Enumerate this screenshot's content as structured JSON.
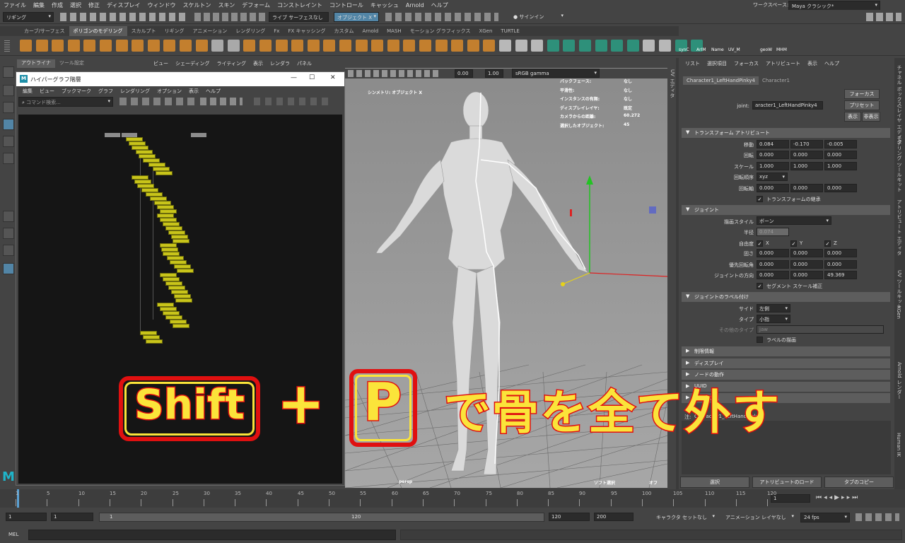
{
  "menubar": [
    "ファイル",
    "編集",
    "作成",
    "選択",
    "修正",
    "ディスプレイ",
    "ウィンドウ",
    "スケルトン",
    "スキン",
    "デフォーム",
    "コンストレイント",
    "コントロール",
    "キャッシュ",
    "Arnold",
    "ヘルプ"
  ],
  "workspace": {
    "label": "ワークスペース:",
    "value": "Maya クラシック*"
  },
  "status": {
    "mode": "リギング",
    "live_surface": "ライブ サーフェスなし",
    "symmetry": "オブジェクト X",
    "signin": "サインイン"
  },
  "shelf_tabs": [
    "カーブ/サーフェス",
    "ポリゴンのモデリング",
    "スカルプト",
    "リギング",
    "アニメーション",
    "レンダリング",
    "Fx",
    "FX キャッシング",
    "カスタム",
    "Arnold",
    "MASH",
    "モーション グラフィックス",
    "XGen",
    "TURTLE"
  ],
  "shelf_active": "ポリゴンのモデリング",
  "shelf_labels": [
    "synC",
    "ArIM",
    "Name",
    "UV_M",
    "geoW",
    "MHM"
  ],
  "outliner_tabs": [
    "アウトライナ",
    "ツール設定"
  ],
  "viewport": {
    "menu": [
      "ビュー",
      "シェーディング",
      "ライティング",
      "表示",
      "レンダラ",
      "パネル"
    ],
    "value1": "0.00",
    "value2": "1.00",
    "colorspace": "sRGB gamma",
    "symmetry_label": "シンメトリ: オブジェクト X",
    "hud": [
      {
        "k": "バックフェース:",
        "v": "なし"
      },
      {
        "k": "平滑性:",
        "v": "なし"
      },
      {
        "k": "インスタンスの有無:",
        "v": "なし"
      },
      {
        "k": "ディスプレイレイヤ:",
        "v": "既定"
      },
      {
        "k": "カメラからの距離:",
        "v": "60.272"
      },
      {
        "k": "選択したオブジェクト:",
        "v": "45"
      }
    ],
    "camera": "persp",
    "soft_select": "ソフト選択",
    "off": "オフ"
  },
  "hypergraph": {
    "title": "ハイパーグラフ階層",
    "menu": [
      "編集",
      "ビュー",
      "ブックマーク",
      "グラフ",
      "レンダリング",
      "オプション",
      "表示",
      "ヘルプ"
    ],
    "search_placeholder": "コマンド検索..."
  },
  "attr": {
    "top_menu": [
      "リスト",
      "選択項目",
      "フォーカス",
      "アトリビュート",
      "表示",
      "ヘルプ"
    ],
    "tabs": [
      "Character1_LeftHandPinky4",
      "Character1"
    ],
    "joint_label": "joint:",
    "joint_value": "aracter1_LeftHandPinky4",
    "focus_btn": "フォーカス",
    "preset_btn": "プリセット",
    "show_btn": "表示",
    "hide_btn": "非表示",
    "sec_transform": "トランスフォーム アトリビュート",
    "translate": {
      "label": "移動",
      "v": [
        "0.084",
        "-0.170",
        "-0.005"
      ]
    },
    "rotate": {
      "label": "回転",
      "v": [
        "0.000",
        "0.000",
        "0.000"
      ]
    },
    "scale": {
      "label": "スケール",
      "v": [
        "1.000",
        "1.000",
        "1.000"
      ]
    },
    "rotorder": {
      "label": "回転順序",
      "v": "xyz"
    },
    "rotaxis": {
      "label": "回転軸",
      "v": [
        "0.000",
        "0.000",
        "0.000"
      ]
    },
    "inherit": "トランスフォームの継承",
    "sec_joint": "ジョイント",
    "drawstyle": {
      "label": "描画スタイル",
      "v": "ボーン"
    },
    "radius": {
      "label": "半径",
      "v": "0.074"
    },
    "dof": {
      "label": "自由度",
      "v": [
        "X",
        "Y",
        "Z"
      ]
    },
    "stiff": {
      "label": "固さ",
      "v": [
        "0.000",
        "0.000",
        "0.000"
      ]
    },
    "prefangle": {
      "label": "優先回転角",
      "v": [
        "0.000",
        "0.000",
        "0.000"
      ]
    },
    "jointorient": {
      "label": "ジョイントの方向",
      "v": [
        "0.000",
        "0.000",
        "49.369"
      ]
    },
    "segscale": "セグメント スケール補正",
    "sec_label": "ジョイントのラベル付け",
    "side": {
      "label": "サイド",
      "v": "左側"
    },
    "type": {
      "label": "タイプ",
      "v": "小指"
    },
    "othertype": {
      "label": "その他のタイプ",
      "v": "jaw"
    },
    "drawlabel": "ラベルの描画",
    "sec_more": [
      "制限情報",
      "ディスプレイ",
      "ノードの動作",
      "UUID",
      "ユーザ定義"
    ],
    "note_label": "注:",
    "note_value": "Character1_LeftHandPinky4",
    "bottom_btns": [
      "選択",
      "アトリビュートのロード",
      "タブのコピー"
    ]
  },
  "side_tabs": [
    "チャネル ボックス/レイヤ エディタ",
    "モデリング ツールキット",
    "アトリビュート エディタ",
    "UV ツールキット",
    "XGen",
    "Arnold レンダー",
    "Human IK"
  ],
  "uv_editor_tab": "UV エディタ",
  "timeline": {
    "ticks": [
      "1",
      "5",
      "10",
      "15",
      "20",
      "25",
      "30",
      "35",
      "40",
      "45",
      "50",
      "55",
      "60",
      "65",
      "70",
      "75",
      "80",
      "85",
      "90",
      "95",
      "100",
      "105",
      "110",
      "115",
      "120"
    ],
    "current": "1"
  },
  "range": {
    "start": "1",
    "start2": "1",
    "slider_start": "1",
    "slider_end": "120",
    "end": "120",
    "end2": "200",
    "char": "キャラクタ セットなし",
    "animlayer": "アニメーション レイヤなし",
    "fps": "24 fps"
  },
  "mel": "MEL",
  "overlay": {
    "shift": "Shift",
    "plus": "+",
    "key": "P",
    "text": "で骨を全て外す"
  }
}
